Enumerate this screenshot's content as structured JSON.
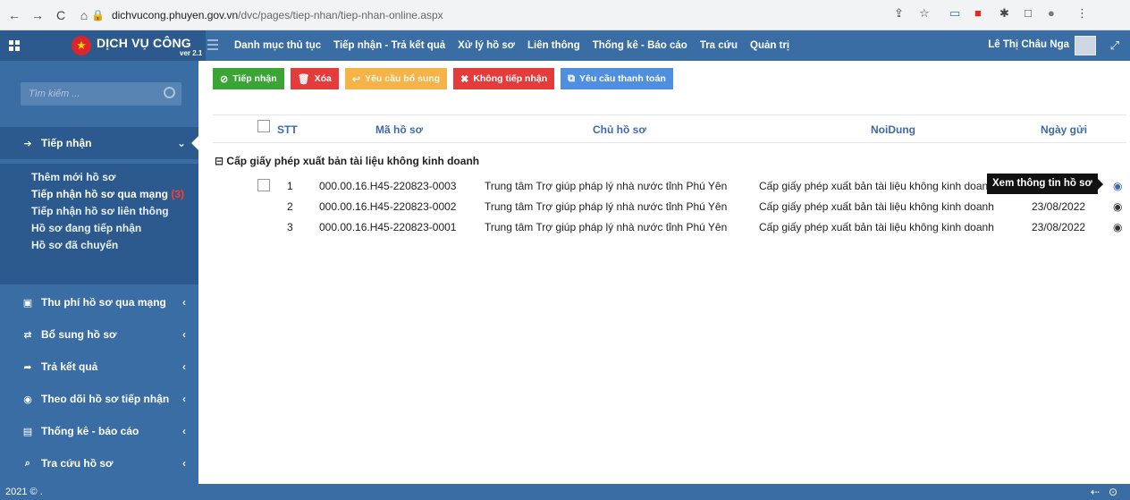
{
  "browser": {
    "url_domain": "dichvucong.phuyen.gov.vn",
    "url_path": "/dvc/pages/tiep-nhan/tiep-nhan-online.aspx"
  },
  "header": {
    "brand": "DỊCH VỤ CÔNG",
    "version": "ver 2.1",
    "nav": [
      "Danh mục thủ tục",
      "Tiếp nhận - Trả kết quả",
      "Xử lý hồ sơ",
      "Liên thông",
      "Thống kê - Báo cáo",
      "Tra cứu",
      "Quản trị"
    ],
    "user_name": "Lê Thị Châu Nga"
  },
  "sidebar": {
    "search_placeholder": "Tìm kiếm ...",
    "active_section": "Tiếp nhận",
    "submenu": [
      "Thêm mới hồ sơ",
      "Tiếp nhận hồ sơ qua mạng",
      "Tiếp nhận hồ sơ liên thông",
      "Hồ sơ đang tiếp nhận",
      "Hồ sơ đã chuyển"
    ],
    "submenu_count": "(3)",
    "sections": [
      "Thu phí hồ sơ qua mạng",
      "Bổ sung hồ sơ",
      "Trả kết quả",
      "Theo dõi hồ sơ tiếp nhận",
      "Thống kê - báo cáo",
      "Tra cứu hồ sơ"
    ]
  },
  "toolbar": {
    "accept": "Tiếp nhận",
    "delete": "Xóa",
    "request_more": "Yêu cầu bổ sung",
    "reject": "Không tiếp nhận",
    "request_payment": "Yêu cầu thanh toán"
  },
  "table": {
    "columns": [
      "STT",
      "Mã hồ sơ",
      "Chủ hồ sơ",
      "NoiDung",
      "Ngày gửi"
    ],
    "group_label": "Cấp giấy phép xuất bản tài liệu không kinh doanh",
    "rows": [
      {
        "stt": "1",
        "ma": "000.00.16.H45-220823-0003",
        "chu": "Trung tâm Trợ giúp pháp lý nhà nước tỉnh Phú Yên",
        "noidung": "Cấp giấy phép xuất bản tài liệu không kinh doan",
        "ngay": ""
      },
      {
        "stt": "2",
        "ma": "000.00.16.H45-220823-0002",
        "chu": "Trung tâm Trợ giúp pháp lý nhà nước tỉnh Phú Yên",
        "noidung": "Cấp giấy phép xuất bản tài liệu không kinh doanh",
        "ngay": "23/08/2022"
      },
      {
        "stt": "3",
        "ma": "000.00.16.H45-220823-0001",
        "chu": "Trung tâm Trợ giúp pháp lý nhà nước tỉnh Phú Yên",
        "noidung": "Cấp giấy phép xuất bản tài liệu không kinh doanh",
        "ngay": "23/08/2022"
      }
    ],
    "tooltip": "Xem thông tin hồ sơ"
  },
  "footer": {
    "copyright": "2021 © ."
  },
  "colors": {
    "sidebar": "#3a6da3",
    "accent_blue": "#3d6aa8"
  }
}
